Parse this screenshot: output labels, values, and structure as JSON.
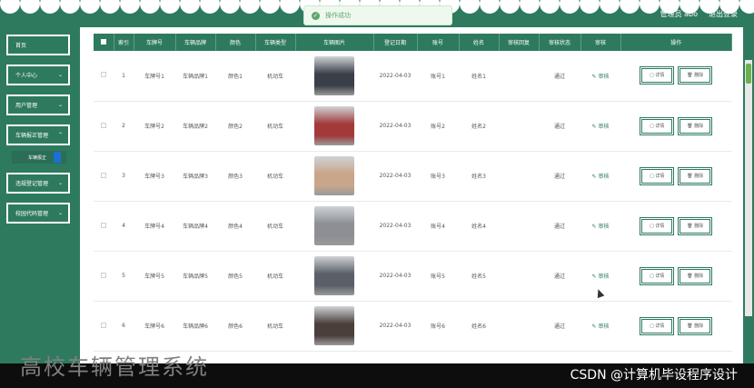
{
  "header": {
    "user_label": "管理员 abo",
    "logout_label": "退出登录"
  },
  "toast": {
    "message": "操作成功"
  },
  "sidebar": {
    "items": [
      {
        "label": "首页"
      },
      {
        "label": "个人中心"
      },
      {
        "label": "用户管理"
      },
      {
        "label": "车辆报正管理"
      },
      {
        "label": "违规登记管理"
      },
      {
        "label": "校园代码管理"
      }
    ],
    "subitem": "车辆报正"
  },
  "table": {
    "headers": [
      "索引",
      "车牌号",
      "车辆品牌",
      "颜色",
      "车辆类型",
      "车辆图片",
      "登记日期",
      "账号",
      "姓名",
      "审核回复",
      "审核状态",
      "审核",
      "操作"
    ],
    "rows": [
      {
        "idx": "1",
        "plate": "车牌号1",
        "brand": "车辆品牌1",
        "color": "颜色1",
        "type": "机动车",
        "date": "2022-04-03",
        "account": "账号1",
        "name": "姓名1",
        "reply": "",
        "status": "通过",
        "audit": "审核",
        "detail": "详情",
        "del": "删除",
        "img": "#3b3f48"
      },
      {
        "idx": "2",
        "plate": "车牌号2",
        "brand": "车辆品牌2",
        "color": "颜色2",
        "type": "机动车",
        "date": "2022-04-03",
        "account": "账号2",
        "name": "姓名2",
        "reply": "",
        "status": "通过",
        "audit": "审核",
        "detail": "详情",
        "del": "删除",
        "img": "#a23a3a"
      },
      {
        "idx": "3",
        "plate": "车牌号3",
        "brand": "车辆品牌3",
        "color": "颜色3",
        "type": "机动车",
        "date": "2022-04-03",
        "account": "账号3",
        "name": "姓名3",
        "reply": "",
        "status": "通过",
        "audit": "审核",
        "detail": "详情",
        "del": "删除",
        "img": "#c9a58a"
      },
      {
        "idx": "4",
        "plate": "车牌号4",
        "brand": "车辆品牌4",
        "color": "颜色4",
        "type": "机动车",
        "date": "2022-04-03",
        "account": "账号4",
        "name": "姓名4",
        "reply": "",
        "status": "通过",
        "audit": "审核",
        "detail": "详情",
        "del": "删除",
        "img": "#8d8f94"
      },
      {
        "idx": "5",
        "plate": "车牌号5",
        "brand": "车辆品牌5",
        "color": "颜色5",
        "type": "机动车",
        "date": "2022-04-03",
        "account": "账号5",
        "name": "姓名5",
        "reply": "",
        "status": "通过",
        "audit": "审核",
        "detail": "详情",
        "del": "删除",
        "img": "#5a6068"
      },
      {
        "idx": "6",
        "plate": "车牌号6",
        "brand": "车辆品牌6",
        "color": "颜色6",
        "type": "机动车",
        "date": "2022-04-03",
        "account": "账号6",
        "name": "姓名6",
        "reply": "",
        "status": "通过",
        "audit": "审核",
        "detail": "详情",
        "del": "删除",
        "img": "#4a3f3a"
      }
    ]
  },
  "footer": {
    "title": "高校车辆管理系统",
    "watermark": "CSDN @计算机毕设程序设计"
  },
  "colors": {
    "accent": "#2e7a5e",
    "footer": "#0d0d0d"
  }
}
